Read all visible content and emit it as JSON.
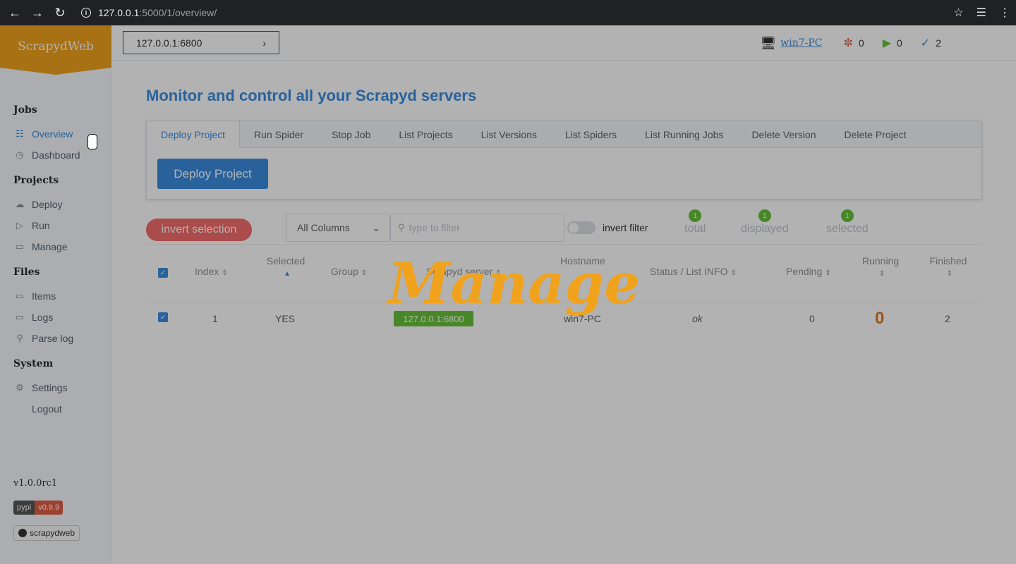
{
  "browser": {
    "url_host": "127.0.0.1",
    "url_path": ":5000/1/overview/"
  },
  "brand": "ScrapydWeb",
  "server_select": {
    "value": "127.0.0.1:6800"
  },
  "top_stats": {
    "host": "win7-PC",
    "pending": "0",
    "running": "0",
    "finished": "2"
  },
  "sidebar": {
    "sections": [
      {
        "title": "Jobs",
        "items": [
          {
            "label": "Overview",
            "icon": "sitemap-icon"
          },
          {
            "label": "Dashboard",
            "icon": "gauge-icon"
          }
        ]
      },
      {
        "title": "Projects",
        "items": [
          {
            "label": "Deploy",
            "icon": "upload-cloud-icon"
          },
          {
            "label": "Run",
            "icon": "play-circle-icon"
          },
          {
            "label": "Manage",
            "icon": "folder-icon"
          }
        ]
      },
      {
        "title": "Files",
        "items": [
          {
            "label": "Items",
            "icon": "folder-icon"
          },
          {
            "label": "Logs",
            "icon": "folder-icon"
          },
          {
            "label": "Parse log",
            "icon": "search-doc-icon"
          }
        ]
      },
      {
        "title": "System",
        "items": [
          {
            "label": "Settings",
            "icon": "gear-icon"
          },
          {
            "label": "Logout",
            "icon": ""
          }
        ]
      }
    ],
    "version": "v1.0.0rc1",
    "pypi_label": "pypi",
    "pypi_version": "v0.9.9",
    "github_label": "scrapydweb"
  },
  "main": {
    "title": "Monitor and control all your Scrapyd servers",
    "tabs": [
      "Deploy Project",
      "Run Spider",
      "Stop Job",
      "List Projects",
      "List Versions",
      "List Spiders",
      "List Running Jobs",
      "Delete Version",
      "Delete Project"
    ],
    "action_button": "Deploy Project"
  },
  "toolbar": {
    "invert_selection": "invert selection",
    "column_select": "All Columns",
    "filter_placeholder": "type to filter",
    "invert_filter": "invert filter",
    "counts": [
      {
        "label": "total",
        "value": "1"
      },
      {
        "label": "displayed",
        "value": "1"
      },
      {
        "label": "selected",
        "value": "1"
      }
    ]
  },
  "table": {
    "headers": [
      "Index",
      "Selected",
      "Group",
      "Scrapyd server",
      "Hostname",
      "Status / List INFO",
      "Pending",
      "Running",
      "Finished"
    ],
    "rows": [
      {
        "index": "1",
        "selected": "YES",
        "group": "",
        "server": "127.0.0.1:6800",
        "hostname": "win7-PC",
        "status": "ok",
        "pending": "0",
        "running": "0",
        "finished": "2"
      }
    ]
  },
  "splash_text": "Manage",
  "colors": {
    "brand": "#f0a21d",
    "accent": "#3c8dde",
    "danger": "#f56c6c",
    "success": "#67c23a",
    "running": "#e6781e"
  }
}
